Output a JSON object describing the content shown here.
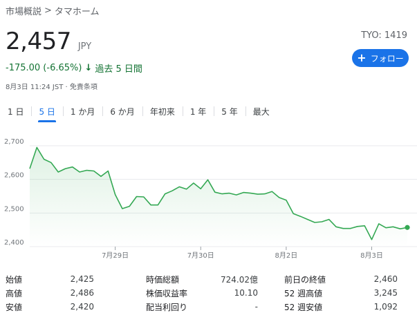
{
  "breadcrumb": {
    "root": "市場概説",
    "separator": ">",
    "current": "タマホーム"
  },
  "quote": {
    "price": "2,457",
    "currency": "JPY",
    "ticker_label": "TYO:",
    "ticker_code": "1419",
    "change": "-175.00 (-6.65%)",
    "period": "過去 5 日間",
    "timestamp": "8月3日 11:24 JST · 免責条項"
  },
  "follow_button": {
    "label": "フォロー"
  },
  "tabs": [
    {
      "label": "1 日"
    },
    {
      "label": "5 日"
    },
    {
      "label": "1 か月"
    },
    {
      "label": "6 か月"
    },
    {
      "label": "年初来"
    },
    {
      "label": "1 年"
    },
    {
      "label": "5 年"
    },
    {
      "label": "最大"
    }
  ],
  "active_tab": "5 日",
  "colors": {
    "line": "#34a853",
    "accent": "#1a73e8",
    "negative": "#137333"
  },
  "chart_data": {
    "type": "area",
    "ylim": [
      2400,
      2700
    ],
    "y_ticks": [
      "2,700",
      "2,600",
      "2,500",
      "2,400"
    ],
    "x_ticks": [
      "7月29日",
      "7月30日",
      "8月2日",
      "8月3日"
    ],
    "series": [
      {
        "values": [
          2632,
          2695,
          2660,
          2650,
          2622,
          2632,
          2637,
          2622,
          2627,
          2625,
          2609,
          2625,
          2555,
          2513,
          2520,
          2549,
          2548,
          2524,
          2524,
          2557,
          2566,
          2578,
          2571,
          2589,
          2572,
          2599,
          2562,
          2557,
          2559,
          2554,
          2561,
          2559,
          2556,
          2557,
          2564,
          2546,
          2538,
          2498,
          2490,
          2481,
          2472,
          2474,
          2481,
          2459,
          2454,
          2454,
          2460,
          2462,
          2421,
          2468,
          2456,
          2459,
          2453,
          2457
        ]
      }
    ]
  },
  "stats": [
    [
      {
        "label": "始値",
        "value": "2,425"
      },
      {
        "label": "時価総額",
        "value": "724.02億"
      },
      {
        "label": "前日の終値",
        "value": "2,460"
      }
    ],
    [
      {
        "label": "高値",
        "value": "2,486"
      },
      {
        "label": "株価収益率",
        "value": "10.10"
      },
      {
        "label": "52 週高値",
        "value": "3,245"
      }
    ],
    [
      {
        "label": "安値",
        "value": "2,420"
      },
      {
        "label": "配当利回り",
        "value": "-"
      },
      {
        "label": "52 週安値",
        "value": "1,092"
      }
    ]
  ]
}
